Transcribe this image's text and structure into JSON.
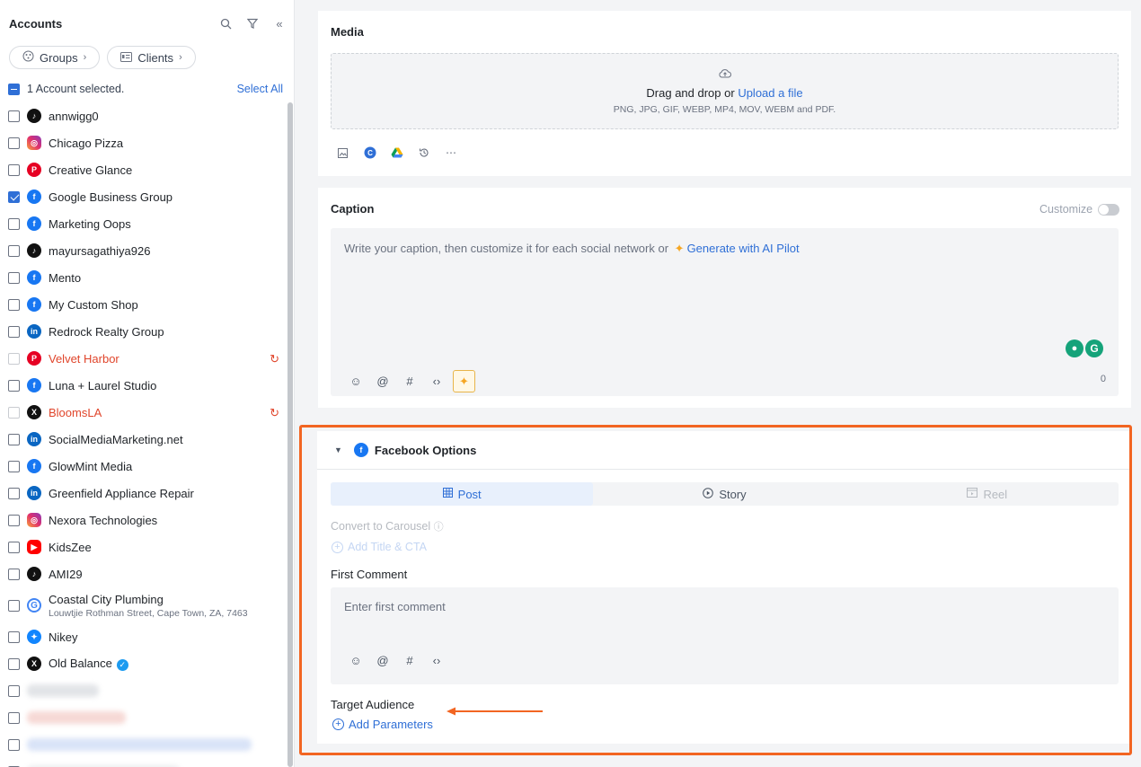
{
  "sidebar": {
    "title": "Accounts",
    "groups_label": "Groups",
    "clients_label": "Clients",
    "selected_text": "1 Account selected.",
    "select_all": "Select All",
    "accounts": [
      {
        "name": "annwigg0",
        "network": "tiktok",
        "checked": false
      },
      {
        "name": "Chicago Pizza",
        "network": "instagram",
        "checked": false
      },
      {
        "name": "Creative Glance",
        "network": "pinterest",
        "checked": false
      },
      {
        "name": "Google Business Group",
        "network": "facebook",
        "checked": true
      },
      {
        "name": "Marketing Oops",
        "network": "facebook",
        "checked": false
      },
      {
        "name": "mayursagathiya926",
        "network": "tiktok",
        "checked": false
      },
      {
        "name": "Mento",
        "network": "facebook",
        "checked": false
      },
      {
        "name": "My Custom Shop",
        "network": "facebook",
        "checked": false
      },
      {
        "name": "Redrock Realty Group",
        "network": "linkedin",
        "checked": false
      },
      {
        "name": "Velvet Harbor",
        "network": "pinterest",
        "checked": false,
        "error": true
      },
      {
        "name": "Luna + Laurel Studio",
        "network": "facebook",
        "checked": false
      },
      {
        "name": "BloomsLA",
        "network": "x",
        "checked": false,
        "error": true
      },
      {
        "name": "SocialMediaMarketing.net",
        "network": "linkedin",
        "checked": false
      },
      {
        "name": "GlowMint Media",
        "network": "facebook",
        "checked": false
      },
      {
        "name": "Greenfield Appliance Repair",
        "network": "linkedin",
        "checked": false
      },
      {
        "name": "Nexora Technologies",
        "network": "instagram",
        "checked": false
      },
      {
        "name": "KidsZee",
        "network": "youtube",
        "checked": false
      },
      {
        "name": "AMI29",
        "network": "tiktok",
        "checked": false
      },
      {
        "name": "Coastal City Plumbing",
        "network": "google",
        "checked": false,
        "subtitle": "Louwtjie Rothman Street, Cape Town, ZA, 7463"
      },
      {
        "name": "Nikey",
        "network": "bluesky",
        "checked": false
      },
      {
        "name": "Old Balance",
        "network": "x",
        "checked": false,
        "verified": true
      }
    ]
  },
  "media": {
    "title": "Media",
    "drop_text": "Drag and drop or",
    "upload_link": "Upload a file",
    "formats": "PNG, JPG, GIF, WEBP, MP4, MOV, WEBM and PDF."
  },
  "caption": {
    "title": "Caption",
    "customize_label": "Customize",
    "placeholder": "Write your caption, then customize it for each social network or",
    "ai_link": "Generate with AI Pilot",
    "char_count": "0"
  },
  "facebook_options": {
    "title": "Facebook Options",
    "tabs": [
      {
        "label": "Post",
        "state": "active"
      },
      {
        "label": "Story",
        "state": "normal"
      },
      {
        "label": "Reel",
        "state": "disabled"
      }
    ],
    "convert_carousel": "Convert to Carousel",
    "add_title_cta": "Add Title & CTA",
    "first_comment_label": "First Comment",
    "first_comment_placeholder": "Enter first comment",
    "target_audience_label": "Target Audience",
    "add_parameters": "Add Parameters"
  },
  "colors": {
    "accent": "#2f6fd6",
    "highlight": "#f26522",
    "error": "#e0452b"
  }
}
